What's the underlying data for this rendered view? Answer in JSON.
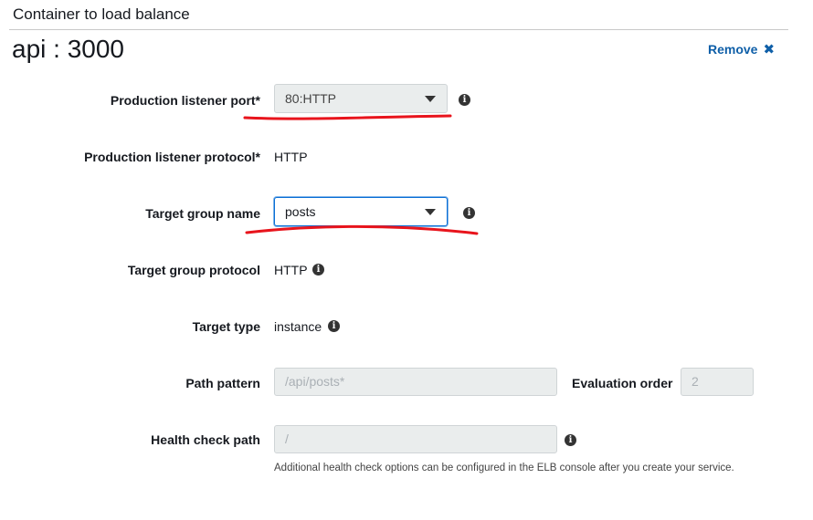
{
  "section": {
    "title": "Container to load balance"
  },
  "container": {
    "name": "api : 3000"
  },
  "actions": {
    "remove_label": "Remove",
    "remove_icon": "close-icon"
  },
  "fields": {
    "listener_port": {
      "label": "Production listener port*",
      "value": "80:HTTP"
    },
    "listener_protocol": {
      "label": "Production listener protocol*",
      "value": "HTTP"
    },
    "target_group_name": {
      "label": "Target group name",
      "value": "posts"
    },
    "target_group_protocol": {
      "label": "Target group protocol",
      "value": "HTTP"
    },
    "target_type": {
      "label": "Target type",
      "value": "instance"
    },
    "path_pattern": {
      "label": "Path pattern",
      "value": "/api/posts*"
    },
    "evaluation_order": {
      "label": "Evaluation order",
      "value": "2"
    },
    "health_check_path": {
      "label": "Health check path",
      "value": "/",
      "help": "Additional health check options can be configured in the ELB console after you create your service."
    }
  },
  "icons": {
    "info": "i"
  },
  "colors": {
    "link": "#0f5fa8",
    "annotation": "#e8141c",
    "focus": "#0a6fd6"
  }
}
